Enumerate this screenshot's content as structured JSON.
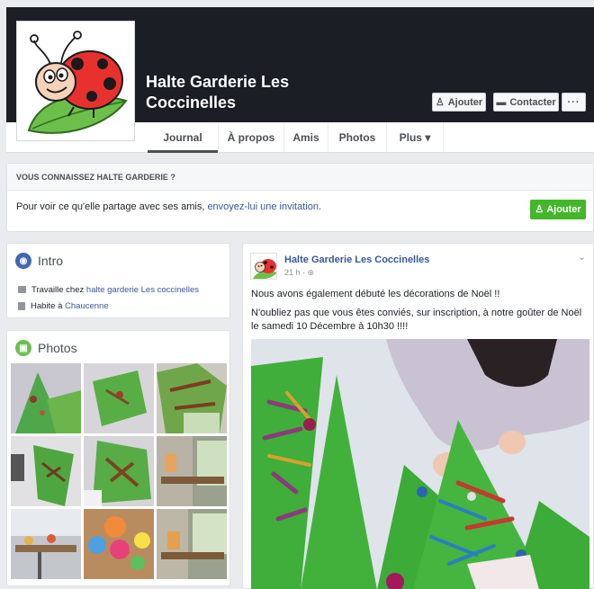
{
  "page": {
    "name": "Halte Garderie Les Coccinelles",
    "add_button": "Ajouter",
    "contact_button": "Contacter",
    "more_button": "···"
  },
  "tabs": [
    {
      "label": "Journal"
    },
    {
      "label": "À propos"
    },
    {
      "label": "Amis"
    },
    {
      "label": "Photos"
    },
    {
      "label": "Plus ▾"
    }
  ],
  "invite": {
    "header": "VOUS CONNAISSEZ HALTE GARDERIE ?",
    "text": "Pour voir ce qu'elle partage avec ses amis, ",
    "link": "envoyez-lui une invitation.",
    "button": "Ajouter"
  },
  "intro": {
    "title": "Intro",
    "work_prefix": "Travaille chez ",
    "work_link": "halte garderie Les coccinelles",
    "home_prefix": "Habite à ",
    "home_link": "Chaucenne"
  },
  "photos": {
    "title": "Photos"
  },
  "post": {
    "author": "Halte Garderie Les Coccinelles",
    "time": "21 h · ",
    "line1": "Nous avons également débuté les décorations de Noël !!",
    "line2": "N'oubliez pas que vous êtes conviés, sur inscription, à notre goûter de Noël le samedi 10 Décembre à 10h30 !!!!"
  },
  "colors": {
    "cover": "#1c1e26",
    "link": "#365899",
    "green": "#42b72a",
    "bg": "#e9ebee"
  }
}
